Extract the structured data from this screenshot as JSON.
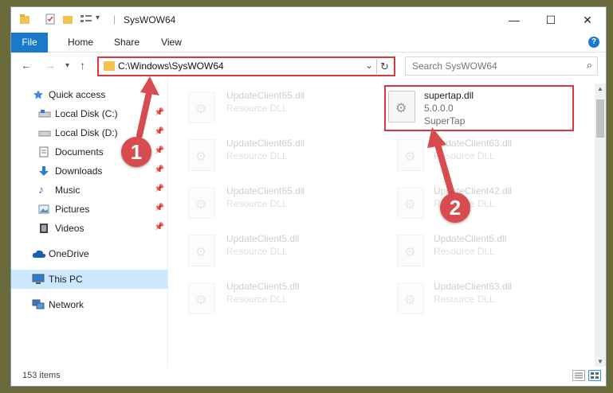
{
  "window": {
    "title": "SysWOW64",
    "minimize": "—",
    "maximize": "☐",
    "close": "✕"
  },
  "ribbon": {
    "tabs": [
      "File",
      "Home",
      "Share",
      "View"
    ],
    "help": "?"
  },
  "navigation": {
    "back": "←",
    "forward": "→",
    "recent": "▾",
    "up": "↑",
    "address": "C:\\Windows\\SysWOW64",
    "address_dropdown": "⌄",
    "refresh": "↻",
    "search_placeholder": "Search SysWOW64",
    "search_icon": "⌕"
  },
  "sidebar": {
    "items": [
      {
        "label": "Quick access",
        "icon": "star-icon"
      },
      {
        "label": "Local Disk (C:)",
        "icon": "drive-icon",
        "pinned": true
      },
      {
        "label": "Local Disk (D:)",
        "icon": "drive-icon",
        "pinned": true
      },
      {
        "label": "Documents",
        "icon": "documents-icon",
        "pinned": true
      },
      {
        "label": "Downloads",
        "icon": "download-icon",
        "pinned": true
      },
      {
        "label": "Music",
        "icon": "music-icon",
        "pinned": true
      },
      {
        "label": "Pictures",
        "icon": "pictures-icon",
        "pinned": true
      },
      {
        "label": "Videos",
        "icon": "videos-icon",
        "pinned": true
      },
      {
        "label": "OneDrive",
        "icon": "cloud-icon"
      },
      {
        "label": "This PC",
        "icon": "computer-icon",
        "selected": true
      },
      {
        "label": "Network",
        "icon": "network-icon"
      }
    ],
    "pin_glyph": "📌"
  },
  "files": [
    {
      "name": "UpdateClient65.dll",
      "type": "Resource DLL",
      "faded": true
    },
    {
      "name": "supertap.dll",
      "version": "5.0.0.0",
      "company": "SuperTap",
      "highlight": true
    },
    {
      "name": "UpdateClient65.dll",
      "type": "Resource DLL",
      "faded": true
    },
    {
      "name": "UpdateClient63.dll",
      "type": "Resource DLL",
      "faded": true
    },
    {
      "name": "UpdateClient65.dll",
      "type": "Resource DLL",
      "faded": true
    },
    {
      "name": "UpdateClient42.dll",
      "type": "Resource DLL",
      "faded": true
    },
    {
      "name": "UpdateClient5.dll",
      "type": "Resource DLL",
      "faded": true
    },
    {
      "name": "UpdateClient5.dll",
      "type": "Resource DLL",
      "faded": true
    },
    {
      "name": "UpdateClient5.dll",
      "type": "Resource DLL",
      "faded": true
    },
    {
      "name": "UpdateClient63.dll",
      "type": "Resource DLL",
      "faded": true
    }
  ],
  "status": {
    "item_count": "153 items"
  },
  "annotations": {
    "step1": "1",
    "step2": "2",
    "color": "#d84b4f"
  },
  "colors": {
    "accent": "#1979ca",
    "highlight_border": "#d9393b",
    "selected_bg": "#cce8ff"
  }
}
